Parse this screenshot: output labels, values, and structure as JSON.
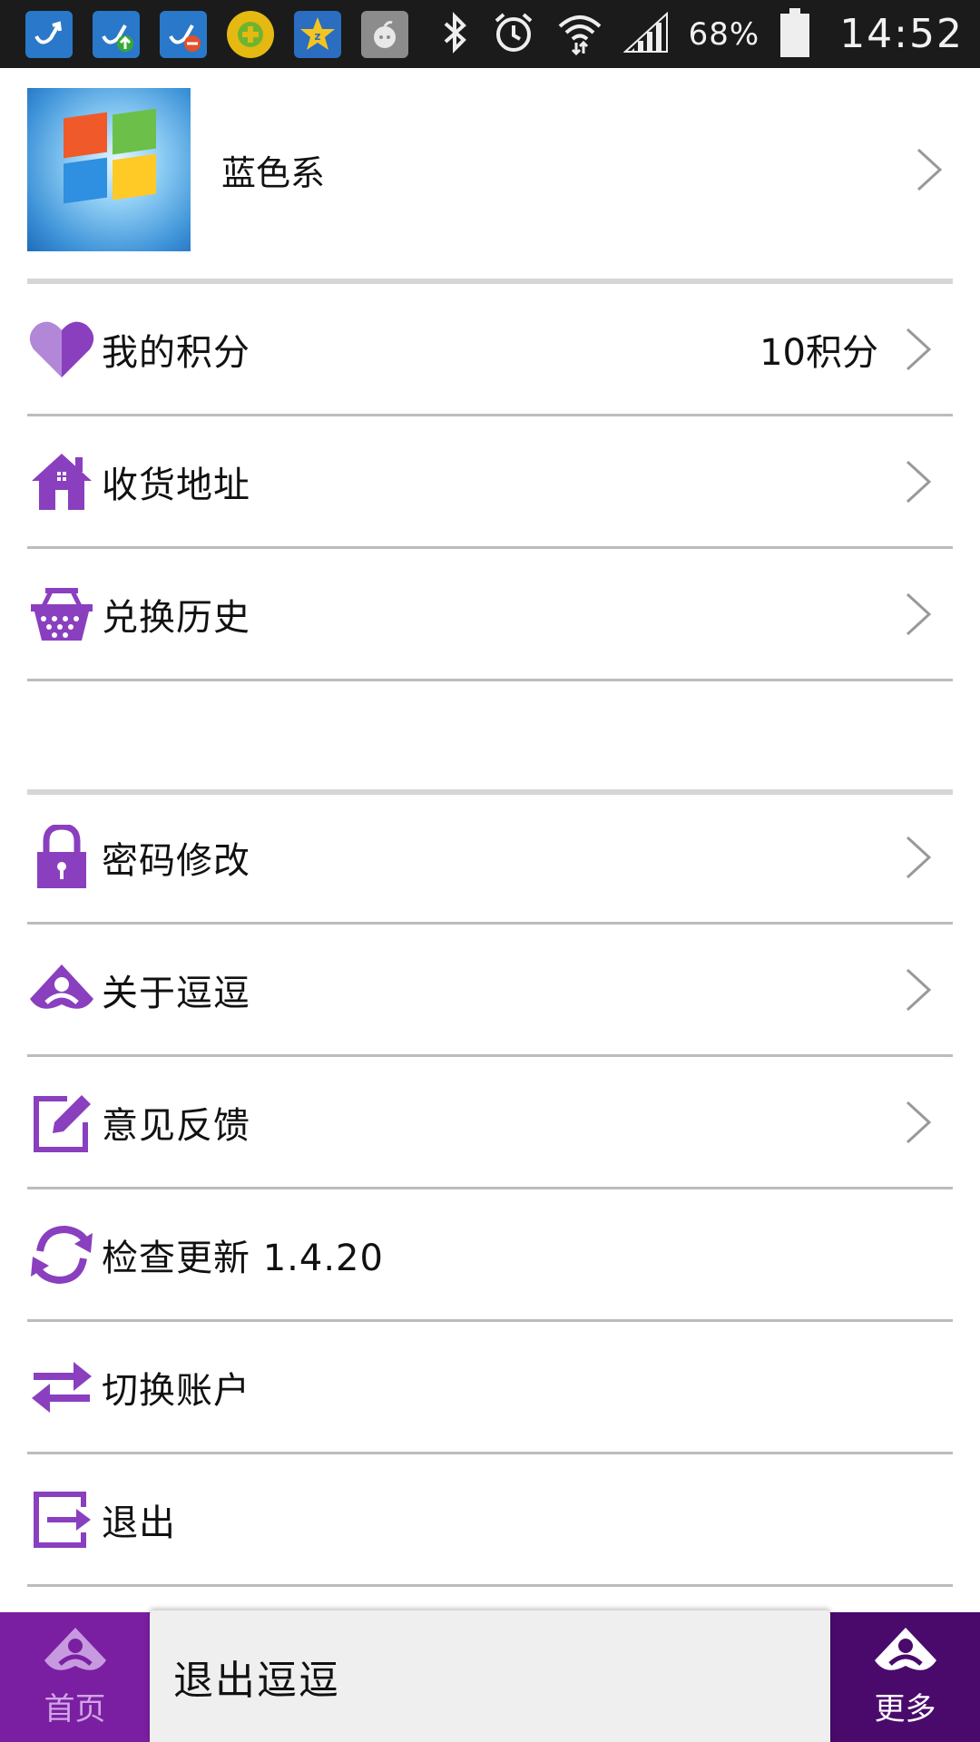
{
  "status_bar": {
    "battery_text": "68%",
    "time": "14:52",
    "notification_icons": [
      "vpn-icon",
      "vpn-up-icon",
      "vpn-minus-icon",
      "plus-circle-icon",
      "star-icon",
      "apple-icon"
    ],
    "system_icons": [
      "bluetooth-icon",
      "alarm-icon",
      "wifi-icon",
      "signal-icon",
      "battery-icon"
    ]
  },
  "profile": {
    "name": "蓝色系"
  },
  "menu_group_1": [
    {
      "label": "我的积分",
      "value": "10积分",
      "icon": "heart-icon"
    },
    {
      "label": "收货地址",
      "value": "",
      "icon": "house-icon"
    },
    {
      "label": "兑换历史",
      "value": "",
      "icon": "basket-icon"
    }
  ],
  "menu_group_2": [
    {
      "label": "密码修改",
      "icon": "lock-icon"
    },
    {
      "label": "关于逗逗",
      "icon": "logo-icon"
    },
    {
      "label": "意见反馈",
      "icon": "edit-icon"
    },
    {
      "label": "检查更新 1.4.20",
      "icon": "refresh-icon"
    },
    {
      "label": "切换账户",
      "icon": "switch-icon"
    },
    {
      "label": "退出",
      "icon": "exit-icon"
    }
  ],
  "bottom_nav": {
    "home_label": "首页",
    "more_label": "更多"
  },
  "popup": {
    "text": "退出逗逗"
  },
  "colors": {
    "accent": "#7b1fa2",
    "accent_dark": "#4a0a6c",
    "icon": "#8a3fbf",
    "separator": "#bcbcbc"
  }
}
